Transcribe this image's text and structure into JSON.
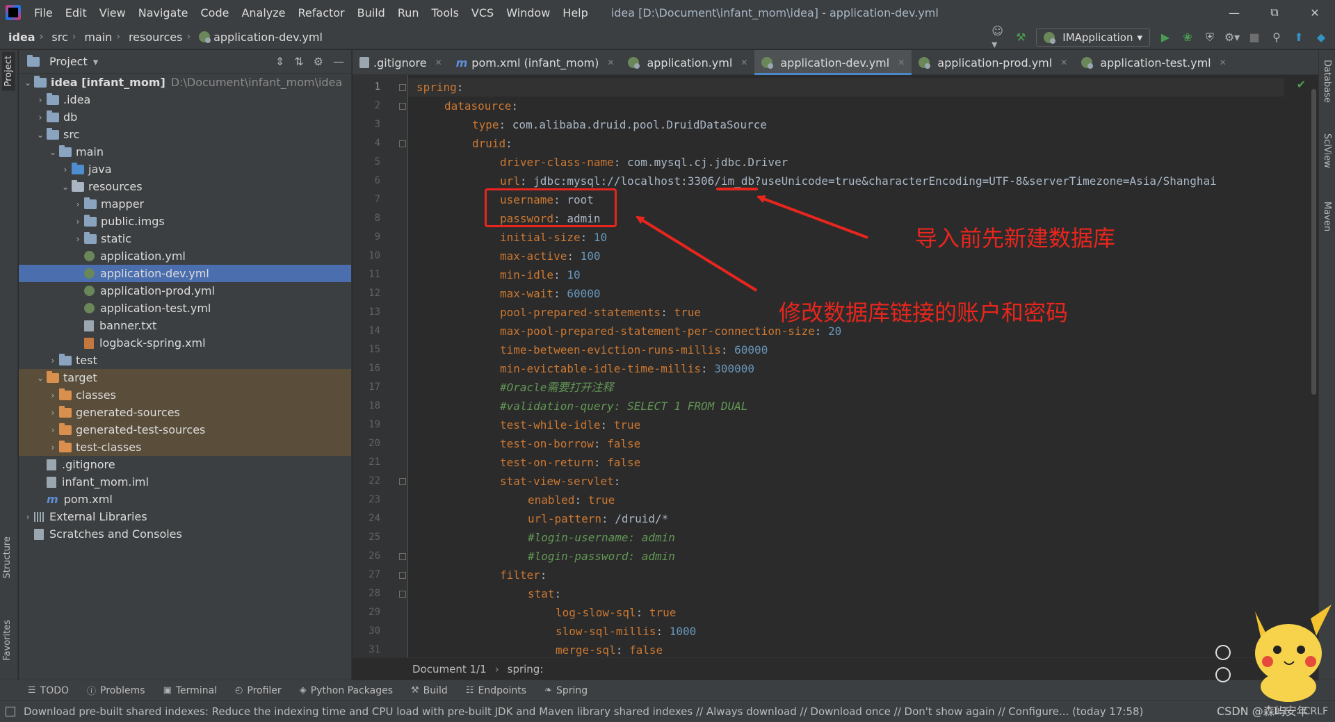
{
  "menubar": {
    "items": [
      "File",
      "Edit",
      "View",
      "Navigate",
      "Code",
      "Analyze",
      "Refactor",
      "Build",
      "Run",
      "Tools",
      "VCS",
      "Window",
      "Help"
    ],
    "window_title": "idea [D:\\Document\\infant_mom\\idea] - application-dev.yml"
  },
  "breadcrumb": [
    "idea",
    "src",
    "main",
    "resources",
    "application-dev.yml"
  ],
  "toolbar": {
    "run_config": "IMApplication"
  },
  "left_stripe": {
    "project": "Project",
    "structure": "Structure",
    "favorites": "Favorites"
  },
  "right_stripe": {
    "database": "Database",
    "sciview": "SciView",
    "maven": "Maven"
  },
  "project_panel": {
    "title": "Project",
    "tree": [
      {
        "label": "idea [infant_mom]",
        "path": "D:\\Document\\infant_mom\\idea",
        "depth": 0,
        "kind": "module",
        "expanded": true
      },
      {
        "label": ".idea",
        "depth": 1,
        "kind": "folder",
        "expanded": false
      },
      {
        "label": "db",
        "depth": 1,
        "kind": "folder",
        "expanded": false
      },
      {
        "label": "src",
        "depth": 1,
        "kind": "folder",
        "expanded": true
      },
      {
        "label": "main",
        "depth": 2,
        "kind": "folder",
        "expanded": true
      },
      {
        "label": "java",
        "depth": 3,
        "kind": "folder-blue",
        "expanded": false
      },
      {
        "label": "resources",
        "depth": 3,
        "kind": "folder-res",
        "expanded": true
      },
      {
        "label": "mapper",
        "depth": 4,
        "kind": "folder",
        "expanded": false
      },
      {
        "label": "public.imgs",
        "depth": 4,
        "kind": "folder",
        "expanded": false
      },
      {
        "label": "static",
        "depth": 4,
        "kind": "folder",
        "expanded": false
      },
      {
        "label": "application.yml",
        "depth": 4,
        "kind": "yml"
      },
      {
        "label": "application-dev.yml",
        "depth": 4,
        "kind": "yml",
        "selected": true
      },
      {
        "label": "application-prod.yml",
        "depth": 4,
        "kind": "yml"
      },
      {
        "label": "application-test.yml",
        "depth": 4,
        "kind": "yml"
      },
      {
        "label": "banner.txt",
        "depth": 4,
        "kind": "txt"
      },
      {
        "label": "logback-spring.xml",
        "depth": 4,
        "kind": "xml"
      },
      {
        "label": "test",
        "depth": 2,
        "kind": "folder",
        "expanded": false
      },
      {
        "label": "target",
        "depth": 1,
        "kind": "folder-orange",
        "expanded": true,
        "excluded": true
      },
      {
        "label": "classes",
        "depth": 2,
        "kind": "folder-orange",
        "expanded": false,
        "excluded": true
      },
      {
        "label": "generated-sources",
        "depth": 2,
        "kind": "folder-orange",
        "expanded": false,
        "excluded": true
      },
      {
        "label": "generated-test-sources",
        "depth": 2,
        "kind": "folder-orange",
        "expanded": false,
        "excluded": true
      },
      {
        "label": "test-classes",
        "depth": 2,
        "kind": "folder-orange",
        "expanded": false,
        "excluded": true
      },
      {
        "label": ".gitignore",
        "depth": 1,
        "kind": "txt"
      },
      {
        "label": "infant_mom.iml",
        "depth": 1,
        "kind": "txt"
      },
      {
        "label": "pom.xml",
        "depth": 1,
        "kind": "m"
      },
      {
        "label": "External Libraries",
        "depth": 0,
        "kind": "libs",
        "expanded": false
      },
      {
        "label": "Scratches and Consoles",
        "depth": 0,
        "kind": "scratch"
      }
    ]
  },
  "editor_tabs": [
    {
      "label": ".gitignore",
      "kind": "git"
    },
    {
      "label": "pom.xml (infant_mom)",
      "kind": "m"
    },
    {
      "label": "application.yml",
      "kind": "yml"
    },
    {
      "label": "application-dev.yml",
      "kind": "yml",
      "active": true
    },
    {
      "label": "application-prod.yml",
      "kind": "yml"
    },
    {
      "label": "application-test.yml",
      "kind": "yml"
    }
  ],
  "code_lines": [
    {
      "n": "1",
      "indent": 0,
      "key": "spring",
      "sep": ":",
      "val": "",
      "vtype": "v"
    },
    {
      "n": "2",
      "indent": 1,
      "key": "datasource",
      "sep": ":",
      "val": "",
      "vtype": "v"
    },
    {
      "n": "3",
      "indent": 2,
      "key": "type",
      "sep": ": ",
      "val": "com.alibaba.druid.pool.DruidDataSource",
      "vtype": "v"
    },
    {
      "n": "4",
      "indent": 2,
      "key": "druid",
      "sep": ":",
      "val": "",
      "vtype": "v"
    },
    {
      "n": "5",
      "indent": 3,
      "key": "driver-class-name",
      "sep": ": ",
      "val": "com.mysql.cj.jdbc.Driver",
      "vtype": "v"
    },
    {
      "n": "6",
      "indent": 3,
      "key": "url",
      "sep": ": ",
      "val": "jdbc:mysql://localhost:3306/im_db?useUnicode=true&characterEncoding=UTF-8&serverTimezone=Asia/Shanghai",
      "vtype": "v"
    },
    {
      "n": "7",
      "indent": 3,
      "key": "username",
      "sep": ": ",
      "val": "root",
      "vtype": "v"
    },
    {
      "n": "8",
      "indent": 3,
      "key": "password",
      "sep": ": ",
      "val": "admin",
      "vtype": "v"
    },
    {
      "n": "9",
      "indent": 3,
      "key": "initial-size",
      "sep": ": ",
      "val": "10",
      "vtype": "n"
    },
    {
      "n": "10",
      "indent": 3,
      "key": "max-active",
      "sep": ": ",
      "val": "100",
      "vtype": "n"
    },
    {
      "n": "11",
      "indent": 3,
      "key": "min-idle",
      "sep": ": ",
      "val": "10",
      "vtype": "n"
    },
    {
      "n": "12",
      "indent": 3,
      "key": "max-wait",
      "sep": ": ",
      "val": "60000",
      "vtype": "n"
    },
    {
      "n": "13",
      "indent": 3,
      "key": "pool-prepared-statements",
      "sep": ": ",
      "val": "true",
      "vtype": "k"
    },
    {
      "n": "14",
      "indent": 3,
      "key": "max-pool-prepared-statement-per-connection-size",
      "sep": ": ",
      "val": "20",
      "vtype": "n"
    },
    {
      "n": "15",
      "indent": 3,
      "key": "time-between-eviction-runs-millis",
      "sep": ": ",
      "val": "60000",
      "vtype": "n"
    },
    {
      "n": "16",
      "indent": 3,
      "key": "min-evictable-idle-time-millis",
      "sep": ": ",
      "val": "300000",
      "vtype": "n"
    },
    {
      "n": "17",
      "indent": 3,
      "key": "",
      "sep": "",
      "val": "#Oracle需要打开注释",
      "vtype": "c"
    },
    {
      "n": "18",
      "indent": 3,
      "key": "",
      "sep": "",
      "val": "#validation-query: SELECT 1 FROM DUAL",
      "vtype": "c"
    },
    {
      "n": "19",
      "indent": 3,
      "key": "test-while-idle",
      "sep": ": ",
      "val": "true",
      "vtype": "k"
    },
    {
      "n": "20",
      "indent": 3,
      "key": "test-on-borrow",
      "sep": ": ",
      "val": "false",
      "vtype": "k"
    },
    {
      "n": "21",
      "indent": 3,
      "key": "test-on-return",
      "sep": ": ",
      "val": "false",
      "vtype": "k"
    },
    {
      "n": "22",
      "indent": 3,
      "key": "stat-view-servlet",
      "sep": ":",
      "val": "",
      "vtype": "v"
    },
    {
      "n": "23",
      "indent": 4,
      "key": "enabled",
      "sep": ": ",
      "val": "true",
      "vtype": "k"
    },
    {
      "n": "24",
      "indent": 4,
      "key": "url-pattern",
      "sep": ": ",
      "val": "/druid/*",
      "vtype": "v"
    },
    {
      "n": "25",
      "indent": 4,
      "key": "",
      "sep": "",
      "val": "#login-username: admin",
      "vtype": "c"
    },
    {
      "n": "26",
      "indent": 4,
      "key": "",
      "sep": "",
      "val": "#login-password: admin",
      "vtype": "c"
    },
    {
      "n": "27",
      "indent": 3,
      "key": "filter",
      "sep": ":",
      "val": "",
      "vtype": "v"
    },
    {
      "n": "28",
      "indent": 4,
      "key": "stat",
      "sep": ":",
      "val": "",
      "vtype": "v"
    },
    {
      "n": "29",
      "indent": 5,
      "key": "log-slow-sql",
      "sep": ": ",
      "val": "true",
      "vtype": "k"
    },
    {
      "n": "30",
      "indent": 5,
      "key": "slow-sql-millis",
      "sep": ": ",
      "val": "1000",
      "vtype": "n"
    },
    {
      "n": "31",
      "indent": 5,
      "key": "merge-sql",
      "sep": ": ",
      "val": "false",
      "vtype": "k"
    }
  ],
  "annotations": {
    "create_db": "导入前先新建数据库",
    "modify_credentials": "修改数据库链接的账户和密码",
    "color": "#e8261d"
  },
  "editor_breadcrumb": [
    "Document 1/1",
    "spring:"
  ],
  "bottom_tabs": [
    {
      "label": "TODO",
      "icon": "list-icon"
    },
    {
      "label": "Problems",
      "icon": "problems-icon"
    },
    {
      "label": "Terminal",
      "icon": "terminal-icon"
    },
    {
      "label": "Profiler",
      "icon": "profiler-icon"
    },
    {
      "label": "Python Packages",
      "icon": "packages-icon"
    },
    {
      "label": "Build",
      "icon": "hammer-icon"
    },
    {
      "label": "Endpoints",
      "icon": "endpoints-icon"
    },
    {
      "label": "Spring",
      "icon": "spring-icon"
    }
  ],
  "status": {
    "message": "Download pre-built shared indexes: Reduce the indexing time and CPU load with pre-built JDK and Maven library shared indexes // Always download // Download once // Don't show again // Configure... (today 17:58)",
    "position": "1:1",
    "line_sep": "CRLF"
  },
  "watermark": "CSDN @森屿安年"
}
